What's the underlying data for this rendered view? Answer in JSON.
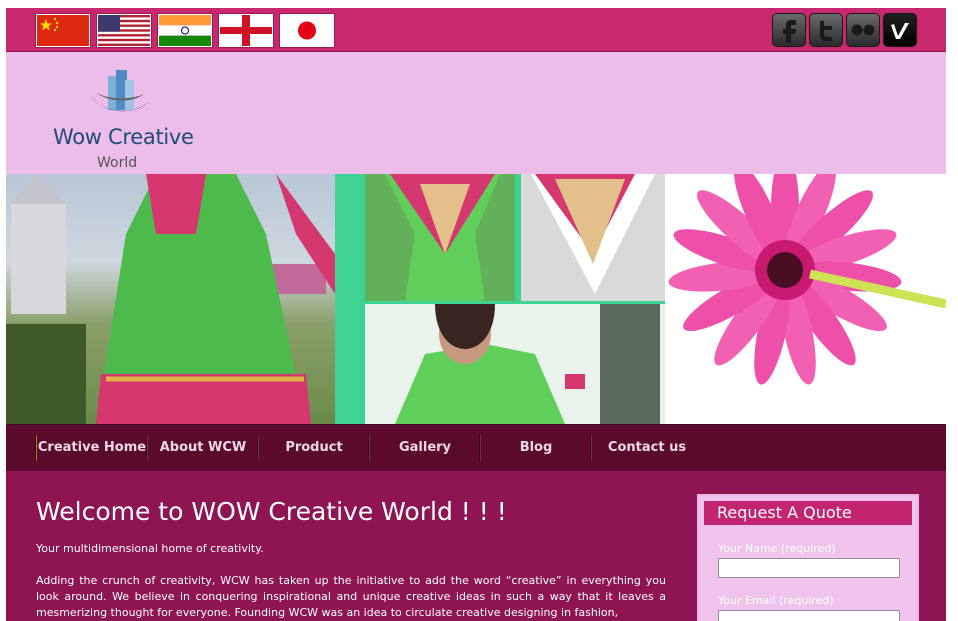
{
  "topbar": {
    "flags": [
      "china-flag",
      "usa-flag",
      "india-flag",
      "england-flag",
      "japan-flag"
    ],
    "social": [
      "facebook-icon",
      "twitter-icon",
      "flickr-icon",
      "vimeo-icon"
    ],
    "bg_color": "#c8286e"
  },
  "header": {
    "logo_main": "Wow Creative",
    "logo_sub": "World",
    "bg_color": "#ecbde9"
  },
  "nav": {
    "items": [
      "Creative Home",
      "About WCW",
      "Product",
      "Gallery",
      "Blog",
      "Contact us"
    ]
  },
  "main": {
    "title": "Welcome to WOW Creative World ! ! !",
    "tagline": "Your multidimensional home of creativity.",
    "paragraph": "Adding the crunch of creativity, WCW has taken up the initiative to add the word “creative” in everything you look around. We believe in conquering inspirational and unique creative ideas in such a way that it leaves a mesmerizing thought for everyone. Founding WCW was an idea to circulate creative designing in fashion,"
  },
  "quote": {
    "title": "Request A Quote",
    "name_label": "Your Name (required)",
    "email_label": "Your Email (required)",
    "name_value": "",
    "email_value": ""
  },
  "colors": {
    "content_bg": "#8e1552",
    "nav_bg": "#5a0a2a",
    "quote_header": "#c3256f"
  }
}
